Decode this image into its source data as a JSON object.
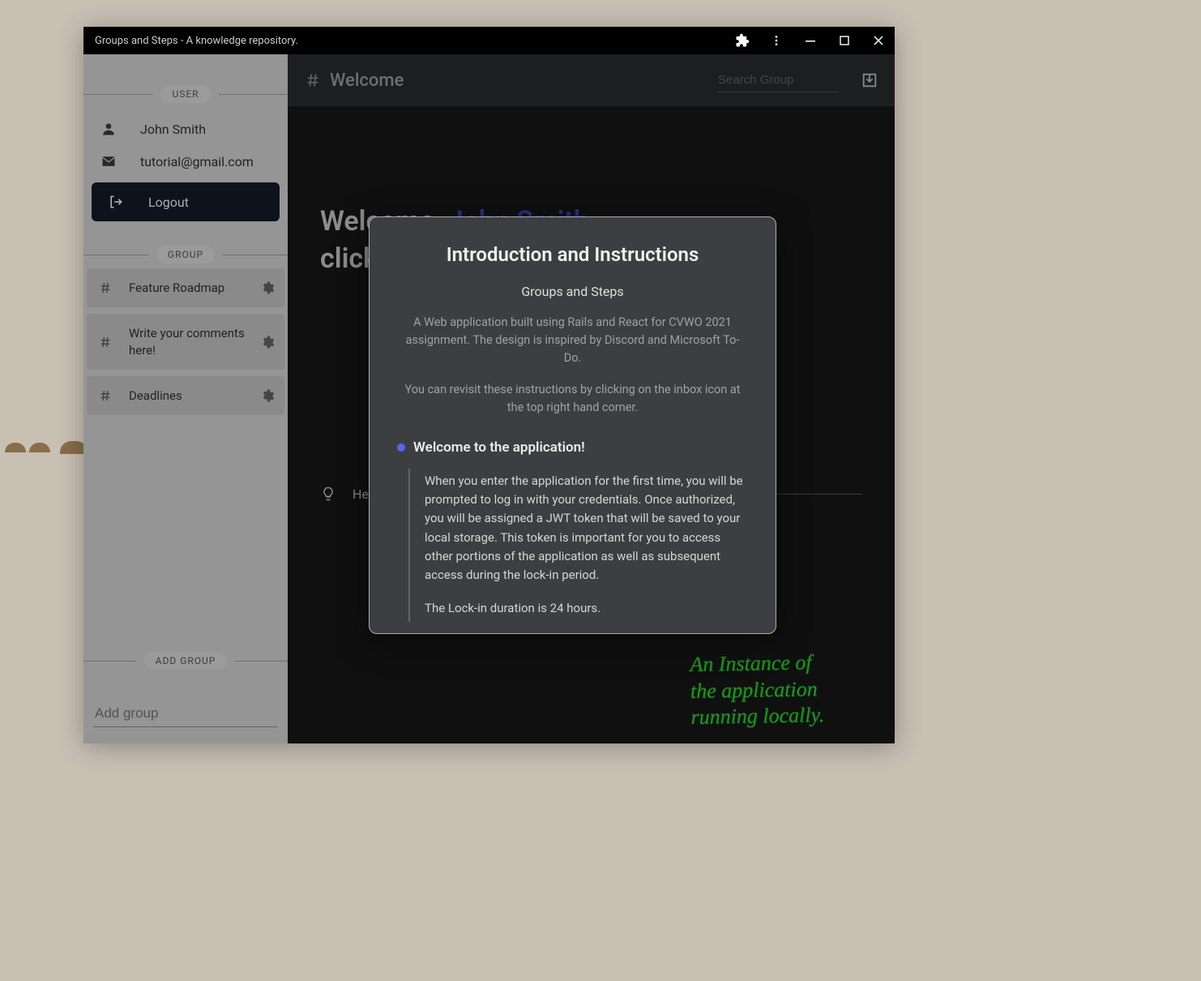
{
  "window": {
    "title": "Groups and Steps - A knowledge repository."
  },
  "sidebar": {
    "user_label": "USER",
    "user_name": "John Smith",
    "user_email": "tutorial@gmail.com",
    "logout_label": "Logout",
    "group_label": "GROUP",
    "groups": [
      {
        "label": "Feature Roadmap"
      },
      {
        "label": "Write your comments here!"
      },
      {
        "label": "Deadlines"
      }
    ],
    "add_group_label": "ADD GROUP",
    "add_group_placeholder": "Add group"
  },
  "topbar": {
    "title": "Welcome",
    "search_placeholder": "Search Group"
  },
  "home": {
    "greeting_prefix": "Welcome, ",
    "greeting_name": "John Smith",
    "greeting_suffix": ",",
    "subgreeting": "click on a group to get started!",
    "starter_hint": "Here's a few to get you started"
  },
  "modal": {
    "title": "Introduction and Instructions",
    "subtitle": "Groups and Steps",
    "para1": "A Web application built using Rails and React for CVWO 2021 assignment. The design is inspired by Discord and Microsoft To-Do.",
    "para2": "You can revisit these instructions by clicking on the inbox icon at the top right hand corner.",
    "step_title": "Welcome to the application!",
    "step_body1": "When you enter the application for the first time, you will be prompted to log in with your credentials. Once authorized, you will be assigned a JWT token that will be saved to your local storage. This token is important for you to access other portions of the application as well as subsequent access during the lock-in period.",
    "step_body2": "The Lock-in duration is 24 hours."
  },
  "annotation": "An Instance of\nthe application\nrunning locally."
}
